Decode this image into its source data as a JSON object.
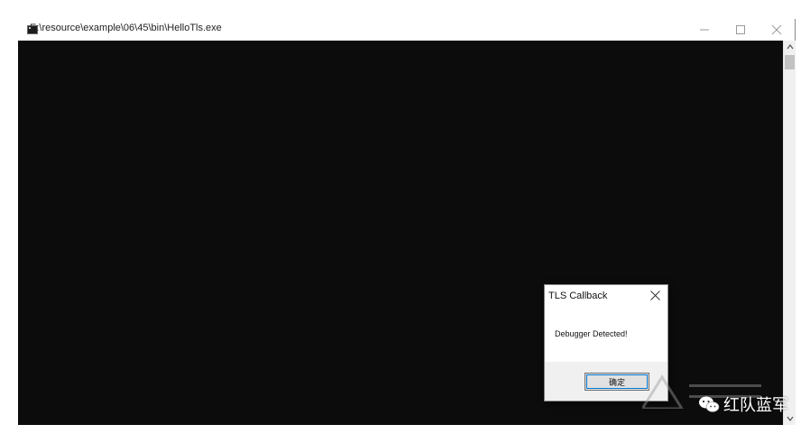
{
  "window": {
    "title": "E:\\resource\\example\\06\\45\\bin\\HelloTls.exe",
    "controls": {
      "minimize_icon": "minimize-icon",
      "maximize_icon": "maximize-icon",
      "close_icon": "close-icon"
    }
  },
  "console": {
    "background": "#0c0c0c"
  },
  "dialog": {
    "title": "TLS Callback",
    "message": "Debugger Detected!",
    "ok_button": "确定"
  },
  "watermark": {
    "text": "红队蓝军"
  },
  "colors": {
    "focus_ring": "#0078d7",
    "dialog_footer": "#f0f0f0",
    "scrollbar": "#f0f0f0"
  }
}
